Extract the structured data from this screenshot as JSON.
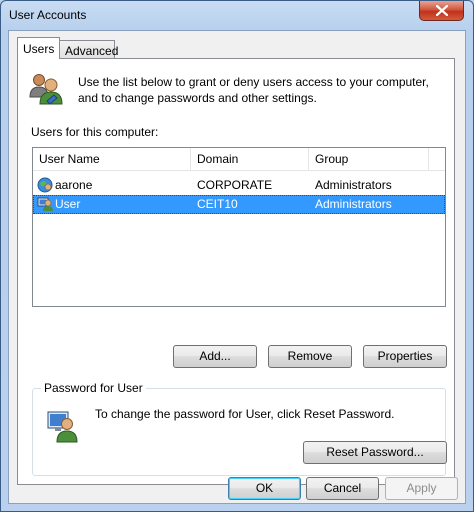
{
  "window": {
    "title": "User Accounts"
  },
  "tabs": [
    {
      "label": "Users"
    },
    {
      "label": "Advanced"
    }
  ],
  "intro": {
    "text": "Use the list below to grant or deny users access to your computer, and to change passwords and other settings."
  },
  "users_list": {
    "label": "Users for this computer:",
    "columns": [
      "User Name",
      "Domain",
      "Group"
    ],
    "rows": [
      {
        "name": "aarone",
        "domain": "CORPORATE",
        "group": "Administrators",
        "selected": false
      },
      {
        "name": "User",
        "domain": "CEIT10",
        "group": "Administrators",
        "selected": true
      }
    ]
  },
  "list_buttons": {
    "add": "Add...",
    "remove": "Remove",
    "properties": "Properties"
  },
  "password_group": {
    "title": "Password for User",
    "text": "To change the password for User, click Reset Password.",
    "reset_button": "Reset Password..."
  },
  "dialog_buttons": {
    "ok": "OK",
    "cancel": "Cancel",
    "apply": "Apply"
  },
  "colors": {
    "selection": "#3399ff",
    "close_button": "#c0311b"
  }
}
